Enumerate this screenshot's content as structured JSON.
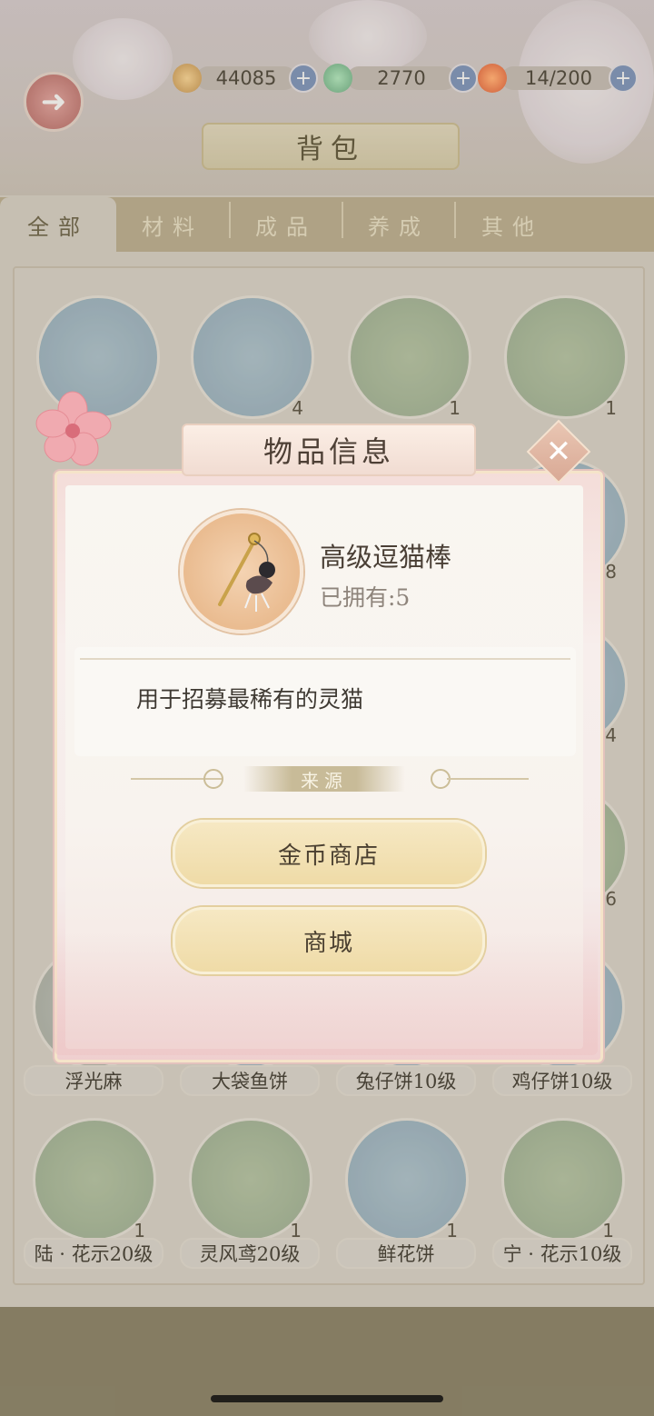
{
  "resources": [
    {
      "name": "paw-coin",
      "value": "44085",
      "color": "#c8a064"
    },
    {
      "name": "leaf-gem",
      "value": "2770",
      "color": "#7eb88f"
    },
    {
      "name": "stamina",
      "value": "14/200",
      "color": "#e07a52"
    }
  ],
  "header": {
    "title": "背包"
  },
  "tabs": [
    {
      "label": "全部",
      "active": true
    },
    {
      "label": "材料",
      "active": false
    },
    {
      "label": "成品",
      "active": false
    },
    {
      "label": "养成",
      "active": false
    },
    {
      "label": "其他",
      "active": false
    }
  ],
  "grid": {
    "row1": [
      {
        "label": "",
        "count": ""
      },
      {
        "label": "",
        "count": "4"
      },
      {
        "label": "",
        "count": "1"
      },
      {
        "label": "",
        "count": "1"
      }
    ],
    "row5": [
      {
        "label": "浮光麻"
      },
      {
        "label": "大袋鱼饼"
      },
      {
        "label": "兔仔饼10级"
      },
      {
        "label": "鸡仔饼10级"
      }
    ],
    "row6": [
      {
        "label": "陆 · 花示20级",
        "count": "1"
      },
      {
        "label": "灵风鸢20级",
        "count": "1"
      },
      {
        "label": "鲜花饼",
        "count": "1"
      },
      {
        "label": "宁 · 花示10级",
        "count": "1"
      }
    ],
    "edge_counts": {
      "r2": "38",
      "r3": "64",
      "r4": "16"
    }
  },
  "modal": {
    "title": "物品信息",
    "item_name": "高级逗猫棒",
    "owned": "已拥有:5",
    "description": "用于招募最稀有的灵猫",
    "source_label": "来源",
    "sources": [
      "金币商店",
      "商城"
    ]
  },
  "icons": {
    "back": "back-arrow-icon",
    "close": "close-icon",
    "plus": "plus-icon"
  }
}
